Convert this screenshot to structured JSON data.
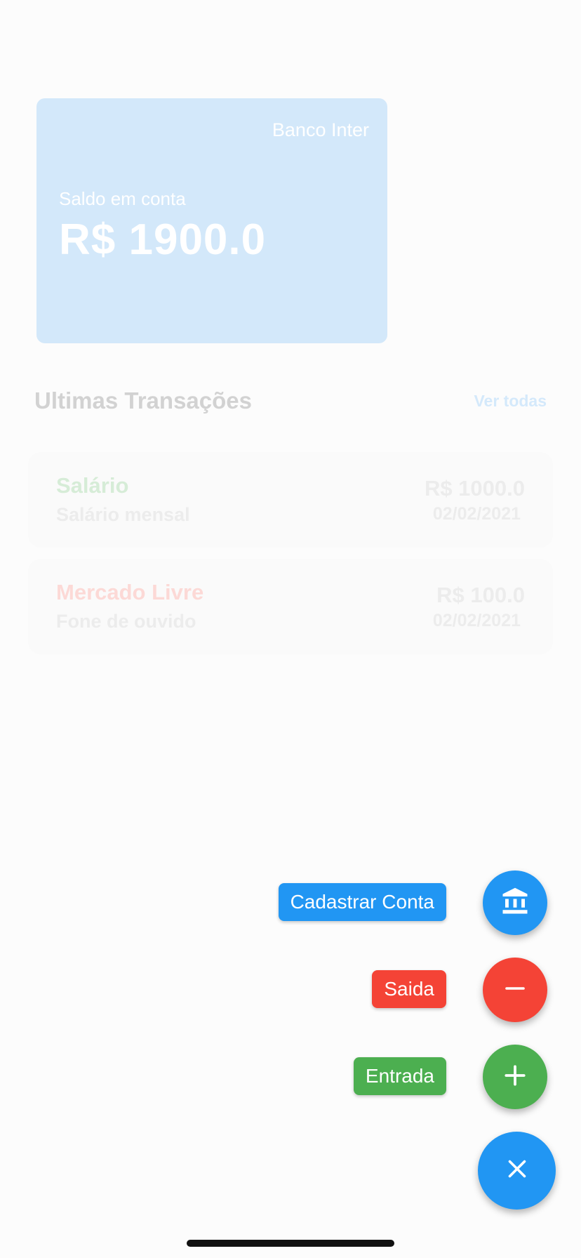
{
  "card": {
    "bank_name": "Banco Inter",
    "balance_label": "Saldo em conta",
    "balance_value": "R$ 1900.0",
    "color": "#d3e8fa"
  },
  "transactions_section": {
    "title": "Ultimas Transações",
    "see_all": "Ver todas"
  },
  "transactions": [
    {
      "name": "Salário",
      "description": "Salário mensal",
      "amount": "R$ 1000.0",
      "date": "02/02/2021",
      "type": "income",
      "color": "#d6ecd7"
    },
    {
      "name": "Mercado Livre",
      "description": "Fone de ouvido",
      "amount": "R$ 100.0",
      "date": "02/02/2021",
      "type": "expense",
      "color": "#fcd9d6"
    }
  ],
  "speed_dial": {
    "actions": [
      {
        "label": "Cadastrar Conta",
        "icon": "bank-icon",
        "color": "#2196f3"
      },
      {
        "label": "Saida",
        "icon": "minus-icon",
        "color": "#f44336"
      },
      {
        "label": "Entrada",
        "icon": "plus-icon",
        "color": "#4caf50"
      }
    ],
    "main_icon": "close-icon",
    "main_color": "#2196f3"
  }
}
